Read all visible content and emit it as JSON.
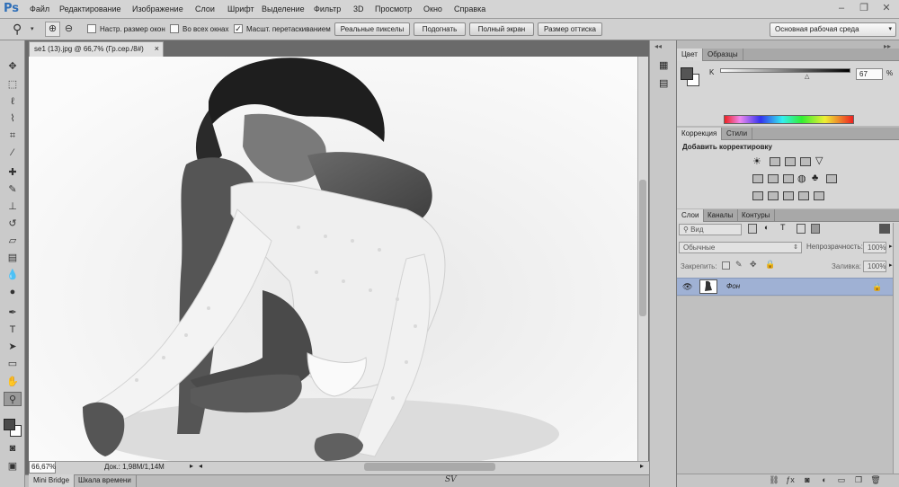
{
  "app": {
    "logo": "Ps"
  },
  "menu": [
    "Файл",
    "Редактирование",
    "Изображение",
    "Слои",
    "Шрифт",
    "Выделение",
    "Фильтр",
    "3D",
    "Просмотр",
    "Окно",
    "Справка"
  ],
  "options": {
    "resize_windows": "Настр. размер окон",
    "all_windows": "Во всех окнах",
    "scrubby_zoom": "Масшт. перетаскиванием",
    "actual_pixels": "Реальные пикселы",
    "fit_screen": "Подогнать",
    "full_screen": "Полный экран",
    "print_size": "Размер оттиска"
  },
  "workspace": "Основная рабочая среда",
  "document": {
    "tab_title": "se1 (13).jpg @ 66,7% (Гр.сер./8#)",
    "close": "×",
    "zoom": "66,67%",
    "info": "Док.: 1,98M/1,14M"
  },
  "bottom_tabs": [
    "Mini Bridge",
    "Шкала времени"
  ],
  "watermark": "SV",
  "color_panel": {
    "tabs": [
      "Цвет",
      "Образцы"
    ],
    "channel": "K",
    "value": "67",
    "unit": "%"
  },
  "adjust_panel": {
    "tabs": [
      "Коррекция",
      "Стили"
    ],
    "title": "Добавить корректировку"
  },
  "layers_panel": {
    "tabs": [
      "Слои",
      "Каналы",
      "Контуры"
    ],
    "filter": "Вид",
    "blend_mode": "Обычные",
    "opacity_label": "Непрозрачность:",
    "opacity": "100%",
    "lock_label": "Закрепить:",
    "fill_label": "Заливка:",
    "fill": "100%",
    "layer_name": "Фон"
  },
  "colors": {
    "accent": "#9fb1d4",
    "logo": "#2f6fb8"
  }
}
